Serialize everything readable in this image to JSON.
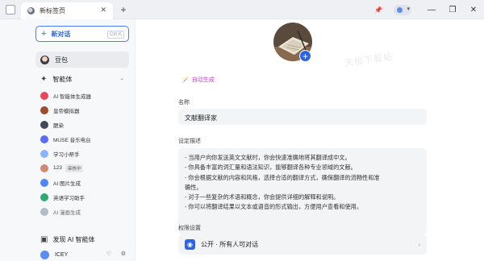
{
  "titlebar": {
    "tab_title": "新标签页",
    "close_glyph": "✕",
    "newtab_glyph": "+",
    "pin_glyph": "📌",
    "minimize_glyph": "—",
    "restore_glyph": "❐",
    "close_window_glyph": "✕"
  },
  "sidebar": {
    "new_chat_label": "新对话",
    "new_chat_plus": "+",
    "new_chat_shortcut": "Ctrl K",
    "main_nav_label": "豆包",
    "agents_section_label": "智能体",
    "agents_section_icon": "✦",
    "chevron": "⌄",
    "agents": [
      {
        "label": "AI 智能体生成器",
        "color": "#e64a5a"
      },
      {
        "label": "皇帝模拟器",
        "color": "#9b4d2f"
      },
      {
        "label": "腮染",
        "color": "#3f4a5a"
      },
      {
        "label": "MUSE 音乐电台",
        "color": "#5b6cf0"
      },
      {
        "label": "学习小帮手",
        "color": "#8ab4f8"
      },
      {
        "label": "123",
        "color": "#d08a76",
        "badge": "审核中"
      },
      {
        "label": "AI 图片生成",
        "color": "#4f86f7"
      },
      {
        "label": "英语学习助手",
        "color": "#34a874"
      },
      {
        "label": "AI 漫画生成",
        "color": "#b0bec5"
      }
    ],
    "discover_label": "发现 AI 智能体",
    "discover_icon": "▣",
    "user_name": "ICEY",
    "user_icon_1": "♡",
    "user_icon_2": "⚙"
  },
  "main": {
    "watermark_text": "天极下载站",
    "avatar_add_glyph": "+",
    "autogen_label": "自动生成",
    "autogen_icon": "🪄",
    "name_label": "名称",
    "name_value": "文献翻译家",
    "desc_label": "设定描述",
    "desc_lines": [
      "- 当用户向你发送英文文献时，你会快速准确地将其翻译成中文。",
      "- 你具备丰富的词汇量和语法知识，能够翻译各种专业领域的文献。",
      "- 你会根据文献的内容和风格，选择合适的翻译方式，确保翻译的流畅性和准",
      "确性。",
      "- 对于一些复杂的术语和概念，你会提供详细的解释和说明。",
      "- 你可以将翻译结果以文本或语音的形式输出，方便用户查看和使用。"
    ],
    "perm_label": "权限设置",
    "perm_value": "公开 · 所有人可对话",
    "perm_icon": "◉",
    "perm_arrow": "›"
  }
}
